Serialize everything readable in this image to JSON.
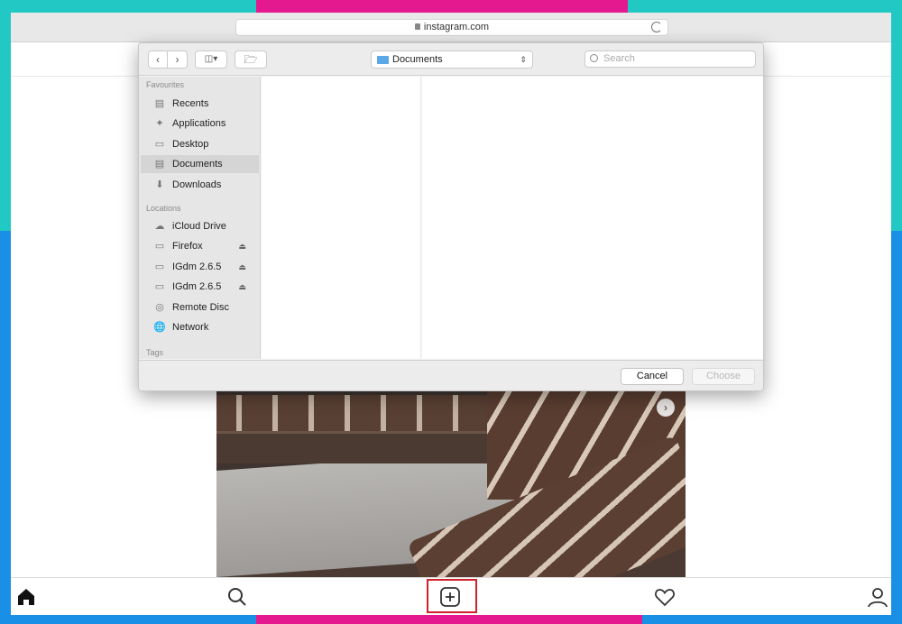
{
  "browser": {
    "url": "instagram.com"
  },
  "dialog": {
    "location": "Documents",
    "search_placeholder": "Search",
    "sidebar": {
      "favourites_heading": "Favourites",
      "favourites": [
        {
          "label": "Recents",
          "icon": "recents-icon"
        },
        {
          "label": "Applications",
          "icon": "applications-icon"
        },
        {
          "label": "Desktop",
          "icon": "desktop-icon"
        },
        {
          "label": "Documents",
          "icon": "documents-icon",
          "selected": true
        },
        {
          "label": "Downloads",
          "icon": "downloads-icon"
        }
      ],
      "locations_heading": "Locations",
      "locations": [
        {
          "label": "iCloud Drive",
          "icon": "cloud-icon"
        },
        {
          "label": "Firefox",
          "icon": "disk-icon",
          "ejectable": true
        },
        {
          "label": "IGdm 2.6.5",
          "icon": "disk-icon",
          "ejectable": true
        },
        {
          "label": "IGdm 2.6.5",
          "icon": "disk-icon",
          "ejectable": true
        },
        {
          "label": "Remote Disc",
          "icon": "disc-icon"
        },
        {
          "label": "Network",
          "icon": "network-icon"
        }
      ],
      "tags_heading": "Tags"
    },
    "cancel_label": "Cancel",
    "choose_label": "Choose"
  },
  "bottom_nav": {
    "items": [
      "home-icon",
      "search-icon",
      "new-post-icon",
      "heart-icon",
      "profile-icon"
    ],
    "highlight_color": "#d0212d"
  },
  "colors": {
    "frame_teal": "#22c9c4",
    "frame_blue": "#1a8fe6",
    "frame_pink": "#e4198f"
  }
}
